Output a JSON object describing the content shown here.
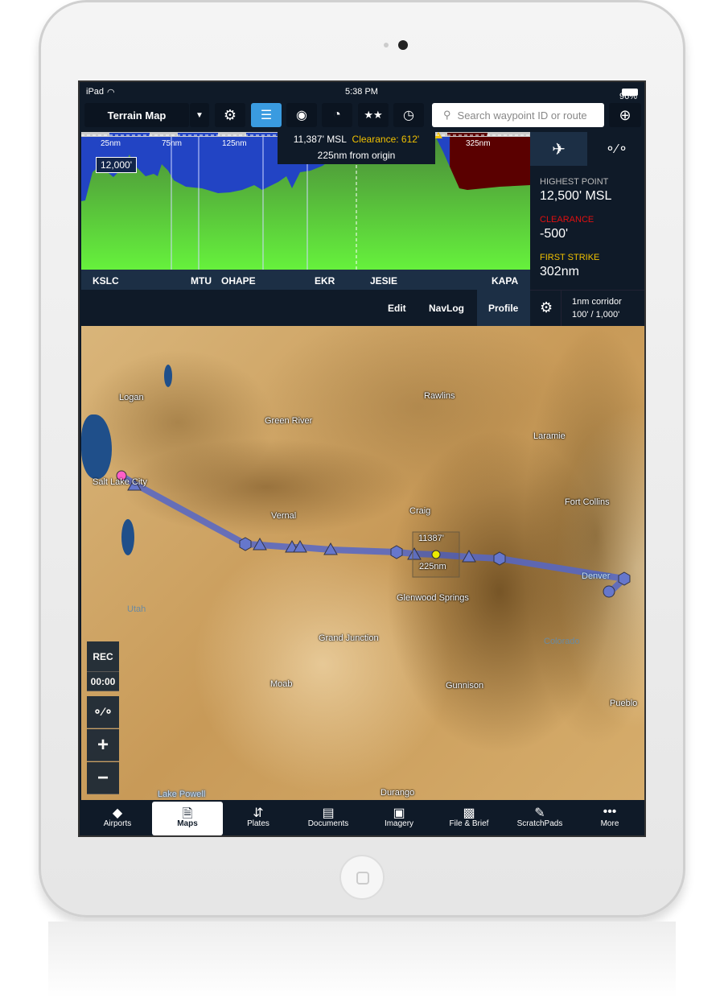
{
  "status": {
    "device": "iPad",
    "time": "5:38 PM",
    "battery": "96%"
  },
  "toolbar": {
    "map_layer": "Terrain Map",
    "search_placeholder": "Search waypoint ID or route"
  },
  "profile": {
    "distance_ticks": [
      "25nm",
      "75nm",
      "125nm",
      "325nm"
    ],
    "altitude_label": "12,000'",
    "tooltip": {
      "altitude": "11,387' MSL",
      "clearance": "Clearance: 612'",
      "distance": "225nm from origin"
    },
    "waypoints": [
      "KSLC",
      "MTU",
      "OHAPE",
      "EKR",
      "JESIE",
      "KAPA"
    ],
    "tabs": [
      "Edit",
      "NavLog",
      "Profile"
    ],
    "active_tab": "Profile"
  },
  "side_panel": {
    "highest_point_label": "HIGHEST POINT",
    "highest_point_value": "12,500' MSL",
    "clearance_label": "CLEARANCE",
    "clearance_value": "-500'",
    "first_strike_label": "FIRST STRIKE",
    "first_strike_value": "302nm",
    "corridor": "1nm corridor",
    "corridor_values": "100' / 1,000'"
  },
  "map": {
    "cities": [
      "Logan",
      "Rawlins",
      "Green River",
      "Laramie",
      "Salt Lake City",
      "Vernal",
      "Craig",
      "Fort Collins",
      "Denver",
      "Glenwood Springs",
      "Grand Junction",
      "Moab",
      "Gunnison",
      "Pueblo",
      "Lake Powell",
      "Durango"
    ],
    "regions": [
      "Utah",
      "Colorado"
    ],
    "route_callout": {
      "altitude": "11387'",
      "distance": "225nm"
    },
    "controls": {
      "rec": "REC",
      "timer": "00:00"
    }
  },
  "tabbar": {
    "items": [
      "Airports",
      "Maps",
      "Plates",
      "Documents",
      "Imagery",
      "File & Brief",
      "ScratchPads",
      "More"
    ],
    "active": "Maps"
  },
  "colors": {
    "accent": "#3a9be0",
    "clearance": "#e01010",
    "warning": "#f0c000",
    "sky": "#2244c4",
    "terrain": "#5fe83a",
    "danger": "#5a0000"
  }
}
